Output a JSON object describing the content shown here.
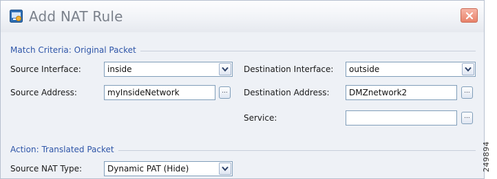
{
  "window": {
    "title": "Add NAT Rule",
    "icons": {
      "app": "nat-rule-icon",
      "close": "close-icon"
    }
  },
  "match_criteria": {
    "heading": "Match Criteria: Original Packet",
    "source_interface": {
      "label": "Source Interface:",
      "value": "inside"
    },
    "destination_interface": {
      "label": "Destination Interface:",
      "value": "outside"
    },
    "source_address": {
      "label": "Source Address:",
      "value": "myInsideNetwork",
      "browse_label": "..."
    },
    "destination_address": {
      "label": "Destination Address:",
      "value": "DMZnetwork2",
      "browse_label": "..."
    },
    "service": {
      "label": "Service:",
      "value": "",
      "browse_label": "..."
    }
  },
  "action": {
    "heading": "Action: Translated Packet",
    "source_nat_type": {
      "label": "Source NAT Type:",
      "value": "Dynamic PAT (Hide)"
    }
  },
  "figure_id": "249894",
  "colors": {
    "section_heading": "#2e55a8",
    "field_border": "#7f9db9",
    "close_button": "#e8826a",
    "dialog_background": "#eef1f6"
  }
}
